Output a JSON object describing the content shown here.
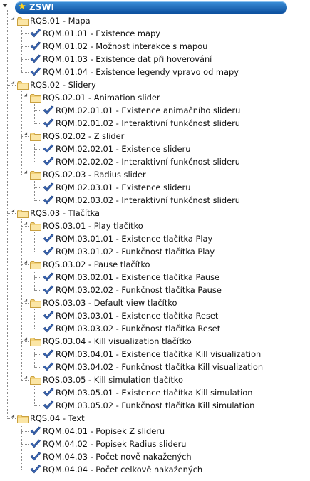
{
  "root": {
    "label": "ZSWI",
    "icon": "star-icon"
  },
  "tree": [
    {
      "label": "RQS.01 - Mapa",
      "children": [
        {
          "label": "RQM.01.01 - Existence mapy"
        },
        {
          "label": "RQM.01.02 - Možnost interakce s mapou"
        },
        {
          "label": "RQM.01.03 - Existence dat při hoverování"
        },
        {
          "label": "RQM.01.04 - Existence legendy vpravo od mapy"
        }
      ]
    },
    {
      "label": "RQS.02 - Slidery",
      "children": [
        {
          "label": "RQS.02.01 - Animation slider",
          "children": [
            {
              "label": "RQM.02.01.01 - Existence animačního slideru"
            },
            {
              "label": "RQM.02.01.02 - Interaktivní funkčnost slideru"
            }
          ]
        },
        {
          "label": "RQS.02.02 - Z slider",
          "children": [
            {
              "label": "RQM.02.02.01 - Existence slideru"
            },
            {
              "label": "RQM.02.02.02 - Interaktivní funkčnost slideru"
            }
          ]
        },
        {
          "label": "RQS.02.03 - Radius slider",
          "children": [
            {
              "label": "RQM.02.03.01 - Existence slideru"
            },
            {
              "label": "RQM.02.03.02 - Interaktivní funkčnost slideru"
            }
          ]
        }
      ]
    },
    {
      "label": "RQS.03 - Tlačítka",
      "children": [
        {
          "label": "RQS.03.01 - Play tlačítko",
          "children": [
            {
              "label": "RQM.03.01.01 - Existence tlačítka Play"
            },
            {
              "label": "RQM.03.01.02 - Funkčnost tlačítka Play"
            }
          ]
        },
        {
          "label": "RQS.03.02 - Pause tlačítko",
          "children": [
            {
              "label": "RQM.03.02.01 - Existence tlačítka Pause"
            },
            {
              "label": "RQM.03.02.02 - Funkčnost tlačítka Pause"
            }
          ]
        },
        {
          "label": "RQS.03.03 - Default view tlačítko",
          "children": [
            {
              "label": "RQM.03.03.01 - Existence tlačítka Reset"
            },
            {
              "label": "RQM.03.03.02 - Funkčnost tlačítka Reset"
            }
          ]
        },
        {
          "label": "RQS.03.04 - Kill visualization tlačítko",
          "children": [
            {
              "label": "RQM.03.04.01 - Existence tlačítka Kill visualization"
            },
            {
              "label": "RQM.03.04.02 - Funkčnost tlačítka Kill visualization"
            }
          ]
        },
        {
          "label": "RQS.03.05 - Kill simulation tlačítko",
          "children": [
            {
              "label": "RQM.03.05.01 - Existence tlačítka Kill simulation"
            },
            {
              "label": "RQM.03.05.02 - Funkčnost tlačítka Kill simulation"
            }
          ]
        }
      ]
    },
    {
      "label": "RQS.04 - Text",
      "children": [
        {
          "label": "RQM.04.01 - Popisek Z slideru"
        },
        {
          "label": "RQM.04.02 - Popisek Radius slideru"
        },
        {
          "label": "RQM.04.03 - Počet nově nakažených"
        },
        {
          "label": "RQM.04.04 - Počet celkově nakažených"
        }
      ]
    }
  ],
  "colors": {
    "root_bar_top": "#3b8fd8",
    "root_bar_bottom": "#0c4f9e",
    "folder": "#f3d27a",
    "folder_dark": "#c9a03f",
    "check": "#3a66b5"
  },
  "icons": {
    "group": "folder-icon",
    "requirement": "checkmark-icon"
  }
}
